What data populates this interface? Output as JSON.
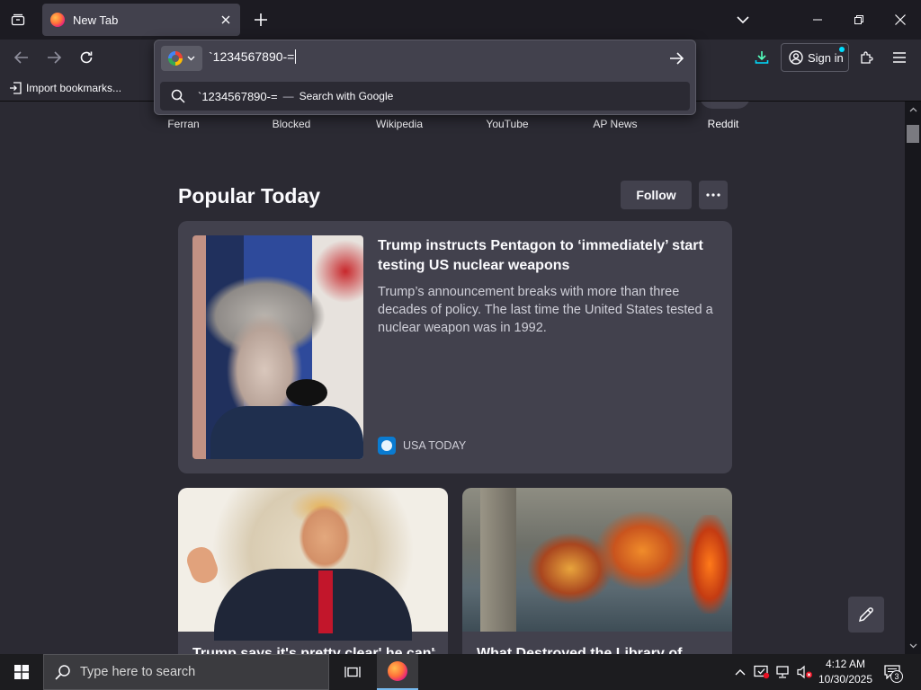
{
  "tab": {
    "title": "New Tab",
    "favicon": "firefox-icon"
  },
  "url_bar": {
    "typed_text": "`1234567890-=",
    "engine": "google-icon",
    "suggestion": {
      "text": "`1234567890-=",
      "dash": "—",
      "action": "Search with Google"
    }
  },
  "nav": {
    "sign_in_label": "Sign in"
  },
  "bookmarks": {
    "import_label": "Import bookmarks..."
  },
  "shortcuts": [
    {
      "label": "Ferran"
    },
    {
      "label": "Blocked"
    },
    {
      "label": "Wikipedia"
    },
    {
      "label": "YouTube"
    },
    {
      "label": "AP News"
    },
    {
      "label": "Reddit"
    }
  ],
  "popular": {
    "title": "Popular Today",
    "follow_label": "Follow",
    "main_story": {
      "headline": "Trump instructs Pentagon to ‘immediately’ start testing US nuclear weapons",
      "excerpt": "Trump’s announcement breaks with more than three decades of policy. The last time the United States tested a nuclear weapon was in 1992.",
      "source": "USA TODAY"
    },
    "small_stories": [
      {
        "headline": "Trump says it's pretty clear' he can't"
      },
      {
        "headline": "What Destroyed the Library of"
      }
    ]
  },
  "taskbar": {
    "search_placeholder": "Type here to search",
    "time": "4:12 AM",
    "date": "10/30/2025",
    "notification_count": "3"
  },
  "colors": {
    "chrome_dark": "#1c1b22",
    "surface": "#2b2a33",
    "card": "#42414d",
    "accent": "#00ddff",
    "download_icon": "#54ffbd"
  }
}
